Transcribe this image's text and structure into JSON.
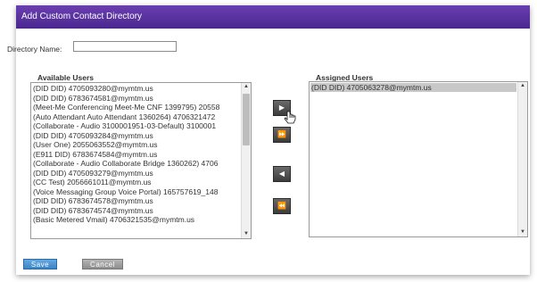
{
  "dialog": {
    "title": "Add Custom Contact Directory"
  },
  "directory": {
    "label": "Directory Name:",
    "value": ""
  },
  "available": {
    "label": "Available Users",
    "items": [
      "(DID DID) 4705093280@mymtm.us",
      "(DID DID) 6783674581@mymtm.us",
      "(Meet-Me Conferencing Meet-Me CNF 1399795) 20558",
      "(Auto Attendant Auto Attendant 1360264) 4706321472",
      "(Collaborate - Audio 3100001951-03-Default) 3100001",
      "(DID DID) 4705093284@mymtm.us",
      "(User One) 2055063552@mymtm.us",
      "(E911 DID) 6783674584@mymtm.us",
      "(Collaborate - Audio Collaborate Bridge 1360262) 4706",
      "(DID DID) 4705093279@mymtm.us",
      "(CC Test) 2056661011@mymtm.us",
      "(Voice Messaging Group Voice Portal) 165757619_148",
      "(DID DID) 6783674578@mymtm.us",
      "(DID DID) 6783674574@mymtm.us",
      "(Basic Metered Vmail) 4706321535@mymtm.us"
    ]
  },
  "assigned": {
    "label": "Assigned Users",
    "items": [
      "(DID DID) 4705063278@mymtm.us"
    ]
  },
  "buttons": {
    "add_one": "▶",
    "add_all": "⏩",
    "remove_one": "◀",
    "remove_all": "⏪",
    "save": "Save",
    "cancel": "Cancel"
  },
  "icons": {
    "scroll_up": "scroll-up-icon",
    "scroll_down": "scroll-down-icon",
    "cursor": "hand-cursor-icon"
  },
  "colors": {
    "title_bar": "#5a33a0",
    "save": "#4a90d2",
    "cancel": "#9e9e9e",
    "selection": "#c8c8c8"
  }
}
